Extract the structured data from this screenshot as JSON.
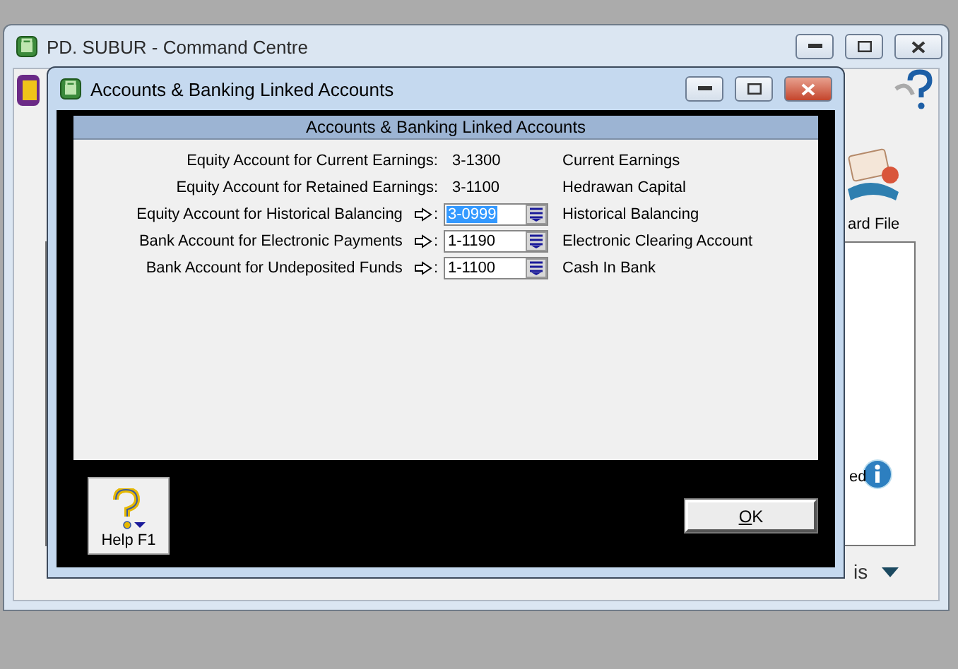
{
  "main_window": {
    "title": "PD. SUBUR - Command Centre",
    "background_labels": [
      {
        "text": "ard File",
        "kind": "label"
      },
      {
        "text": "ed",
        "kind": "label"
      },
      {
        "text": "is",
        "kind": "dropdown"
      }
    ]
  },
  "dialog": {
    "title": "Accounts & Banking Linked Accounts",
    "panel_header": "Accounts & Banking Linked Accounts",
    "rows": [
      {
        "kind": "static",
        "label": "Equity Account for Current Earnings:",
        "account": "3-1300",
        "name": "Current Earnings"
      },
      {
        "kind": "static",
        "label": "Equity Account for Retained Earnings:",
        "account": "3-1100",
        "name": "Hedrawan Capital"
      },
      {
        "kind": "field",
        "label": "Equity Account for Historical Balancing",
        "colon": ":",
        "account": "3-0999",
        "selected": true,
        "name": "Historical Balancing"
      },
      {
        "kind": "field",
        "label": "Bank Account for Electronic Payments",
        "colon": ":",
        "account": "1-1190",
        "selected": false,
        "name": "Electronic Clearing Account"
      },
      {
        "kind": "field",
        "label": "Bank Account for Undeposited Funds",
        "colon": ":",
        "account": "1-1100",
        "selected": false,
        "name": "Cash In Bank"
      }
    ],
    "help_button": "Help F1",
    "ok_button": {
      "access_key": "O",
      "rest": "K"
    }
  }
}
